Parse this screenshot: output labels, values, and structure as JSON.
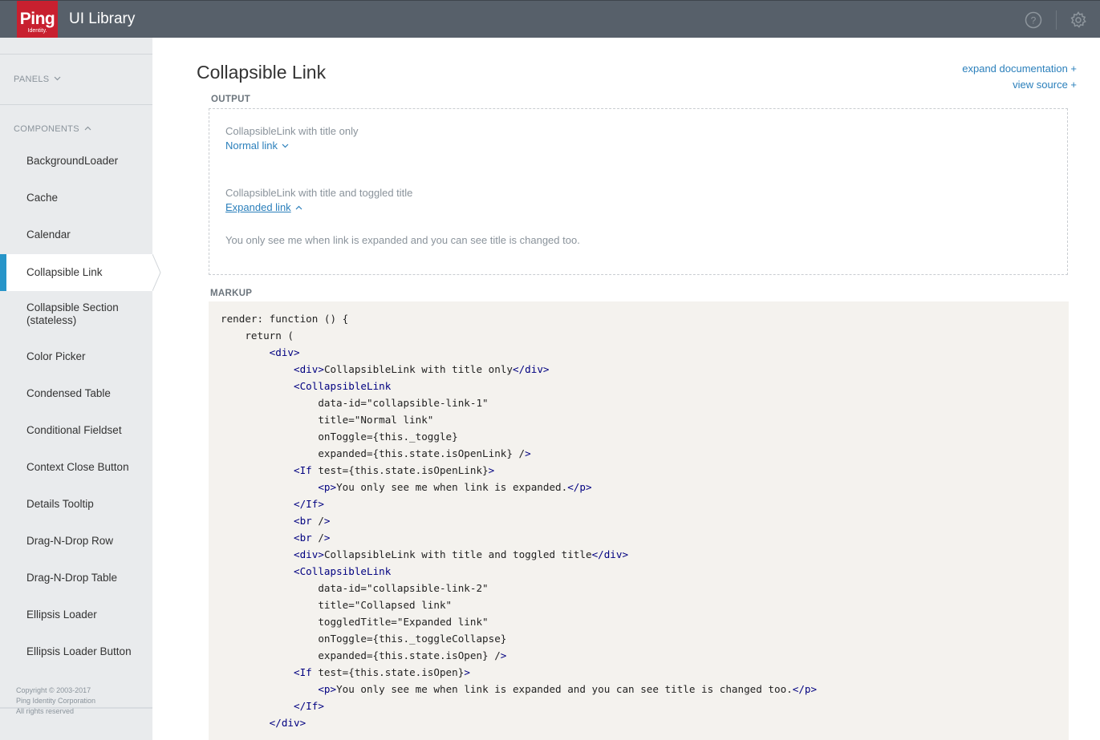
{
  "header": {
    "logo_main": "Ping",
    "logo_sub": "Identity.",
    "app_title": "UI Library",
    "help_icon": "help-circle-icon",
    "settings_icon": "gear-icon",
    "bg_color": "#57606a",
    "logo_color": "#c8202f"
  },
  "sidebar": {
    "panels_label": "PANELS",
    "components_label": "COMPONENTS",
    "items": [
      {
        "label": "BackgroundLoader"
      },
      {
        "label": "Cache"
      },
      {
        "label": "Calendar"
      },
      {
        "label": "Collapsible Link",
        "active": true
      },
      {
        "label": "Collapsible Section (stateless)"
      },
      {
        "label": "Color Picker"
      },
      {
        "label": "Condensed Table"
      },
      {
        "label": "Conditional Fieldset"
      },
      {
        "label": "Context Close Button"
      },
      {
        "label": "Details Tooltip"
      },
      {
        "label": "Drag-N-Drop Row"
      },
      {
        "label": "Drag-N-Drop Table"
      },
      {
        "label": "Ellipsis Loader"
      },
      {
        "label": "Ellipsis Loader Button"
      }
    ],
    "copyright": [
      "Copyright © 2003-2017",
      "Ping Identity Corporation",
      "All rights reserved"
    ],
    "active_color": "#2795c9"
  },
  "main": {
    "title": "Collapsible Link",
    "expand_documentation": "expand documentation +",
    "view_source": "view source +",
    "output_label": "OUTPUT",
    "markup_label": "MARKUP",
    "output": {
      "example1_label": "CollapsibleLink with title only",
      "example1_link": "Normal link",
      "example2_label": "CollapsibleLink with title and toggled title",
      "example2_link": "Expanded link",
      "expanded_text": "You only see me when link is expanded and you can see title is changed too."
    },
    "code_lines": [
      "render: function () {",
      "    return (",
      "        <div>",
      "            <div>CollapsibleLink with title only</div>",
      "            <CollapsibleLink",
      "                data-id=\"collapsible-link-1\"",
      "                title=\"Normal link\"",
      "                onToggle={this._toggle}",
      "                expanded={this.state.isOpenLink} />",
      "            <If test={this.state.isOpenLink}>",
      "                <p>You only see me when link is expanded.</p>",
      "            </If>",
      "            <br />",
      "            <br />",
      "            <div>CollapsibleLink with title and toggled title</div>",
      "            <CollapsibleLink",
      "                data-id=\"collapsible-link-2\"",
      "                title=\"Collapsed link\"",
      "                toggledTitle=\"Expanded link\"",
      "                onToggle={this._toggleCollapse}",
      "                expanded={this.state.isOpen} />",
      "            <If test={this.state.isOpen}>",
      "                <p>You only see me when link is expanded and you can see title is changed too.</p>",
      "            </If>",
      "        </div>"
    ],
    "link_color": "#2a7fbb"
  }
}
